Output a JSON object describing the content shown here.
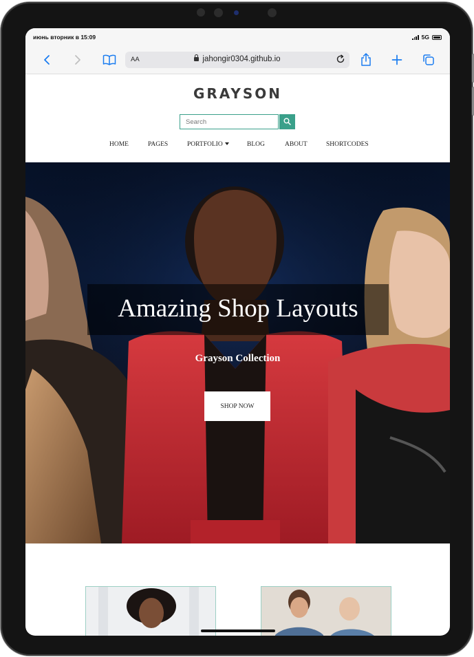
{
  "status_bar": {
    "time": "июнь вторник в 15:09",
    "network": "5G"
  },
  "browser": {
    "text_size_label": "AA",
    "url": "jahongir0304.github.io",
    "icons": [
      "back-icon",
      "forward-icon",
      "bookmarks-icon",
      "lock-icon",
      "reload-icon",
      "share-icon",
      "new-tab-icon",
      "tabs-icon"
    ]
  },
  "site": {
    "logo": "GRAYSON",
    "search_placeholder": "Search",
    "nav": [
      "HOME",
      "PAGES",
      "PORTFOLIO",
      "BLOG",
      "ABOUT",
      "SHORTCODES"
    ]
  },
  "hero": {
    "title": "Amazing Shop Layouts",
    "subtitle": "Grayson Collection",
    "button_label": "SHOP NOW"
  },
  "colors": {
    "accent": "#3aa08a",
    "hero_background": "#0a1a38",
    "jacket_red": "#c8232e"
  }
}
